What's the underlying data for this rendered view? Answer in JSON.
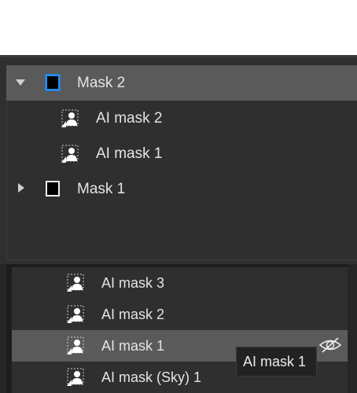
{
  "mask_tree": {
    "groups": [
      {
        "label": "Mask 2",
        "expanded": true,
        "selected": true,
        "children": [
          {
            "label": "AI mask 2"
          },
          {
            "label": "AI mask 1"
          }
        ]
      },
      {
        "label": "Mask 1",
        "expanded": false,
        "selected": false
      }
    ]
  },
  "component_list": {
    "items": [
      {
        "label": "AI mask 3"
      },
      {
        "label": "AI mask 2"
      },
      {
        "label": "AI mask 1",
        "selected": true,
        "icon": "visibility-toggle-icon"
      },
      {
        "label": "AI mask (Sky) 1"
      }
    ]
  },
  "tooltip": {
    "text": "AI mask 1"
  },
  "colors": {
    "panel": "#2f2f2f",
    "selected_row": "#5a5a5a",
    "accent": "#2b8fe8"
  }
}
